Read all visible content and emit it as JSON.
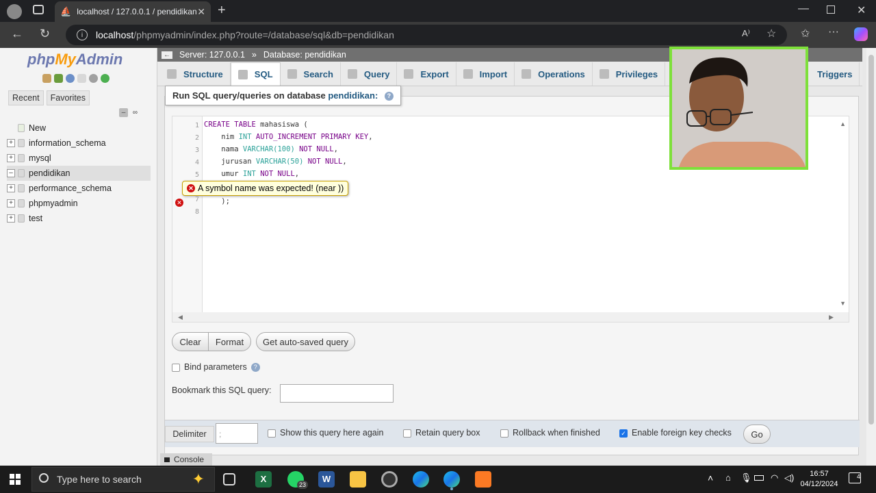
{
  "browser": {
    "tab_title": "localhost / 127.0.0.1 / pendidikan",
    "url_host": "localhost",
    "url_path": "/phpmyadmin/index.php?route=/database/sql&db=pendidikan"
  },
  "nav": {
    "logo_php": "php",
    "logo_my": "My",
    "logo_admin": "Admin",
    "recent": "Recent",
    "favorites": "Favorites",
    "tree": [
      "New",
      "information_schema",
      "mysql",
      "pendidikan",
      "performance_schema",
      "phpmyadmin",
      "test"
    ]
  },
  "breadcrumb": {
    "server": "Server: 127.0.0.1",
    "database": "Database: pendidikan"
  },
  "tabs": [
    "Structure",
    "SQL",
    "Search",
    "Query",
    "Export",
    "Import",
    "Operations",
    "Privileges",
    "Triggers"
  ],
  "sql": {
    "legend": "Run SQL query/queries on database",
    "db_name": "pendidikan:",
    "error_tooltip": "A symbol name was expected! (near ))",
    "line_numbers": [
      "1",
      "2",
      "3",
      "4",
      "5",
      "6",
      "7",
      "8"
    ]
  },
  "buttons": {
    "clear": "Clear",
    "format": "Format",
    "autosaved": "Get auto-saved query",
    "go": "Go"
  },
  "options": {
    "bind_parameters": "Bind parameters",
    "bookmark": "Bookmark this SQL query:",
    "delimiter_label": "Delimiter",
    "delimiter_value": ";",
    "show_query": "Show this query here again",
    "retain": "Retain query box",
    "rollback": "Rollback when finished",
    "fk_checks": "Enable foreign key checks"
  },
  "console": "Console",
  "taskbar": {
    "search_placeholder": "Type here to search",
    "time": "16:57",
    "date": "04/12/2024",
    "whatsapp_badge": "23",
    "notif_badge": "4"
  }
}
